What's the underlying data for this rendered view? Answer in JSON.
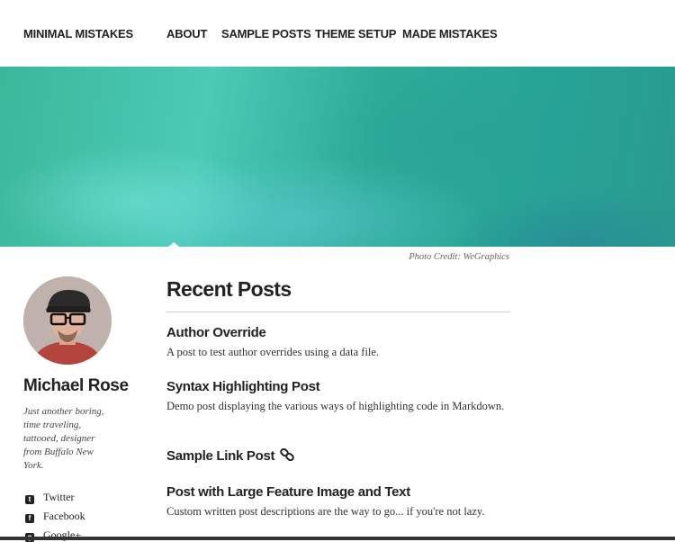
{
  "nav": {
    "site_title": "MINIMAL MISTAKES",
    "links": [
      "ABOUT",
      "SAMPLE POSTS",
      "THEME SETUP",
      "MADE MISTAKES"
    ]
  },
  "hero": {
    "photo_credit": "Photo Credit: WeGraphics"
  },
  "author": {
    "name": "Michael Rose",
    "bio": "Just another boring, time traveling, tattooed, designer from Buffalo New York.",
    "social": [
      {
        "label": "Twitter",
        "icon": "twitter-icon"
      },
      {
        "label": "Facebook",
        "icon": "facebook-icon"
      },
      {
        "label": "Google+",
        "icon": "google-plus-icon"
      }
    ]
  },
  "recent": {
    "title": "Recent Posts",
    "posts": [
      {
        "title": "Author Override",
        "desc": "A post to test author overrides using a data file."
      },
      {
        "title": "Syntax Highlighting Post",
        "desc": "Demo post displaying the various ways of highlighting code in Markdown."
      },
      {
        "title": "Sample Link Post",
        "desc": "",
        "icon": "link-icon"
      },
      {
        "title": "Post with Large Feature Image and Text",
        "desc": "Custom written post descriptions are the way to go... if you're not lazy."
      }
    ]
  },
  "colors": {
    "hero_teal": "#2eab98",
    "text": "#222222"
  }
}
